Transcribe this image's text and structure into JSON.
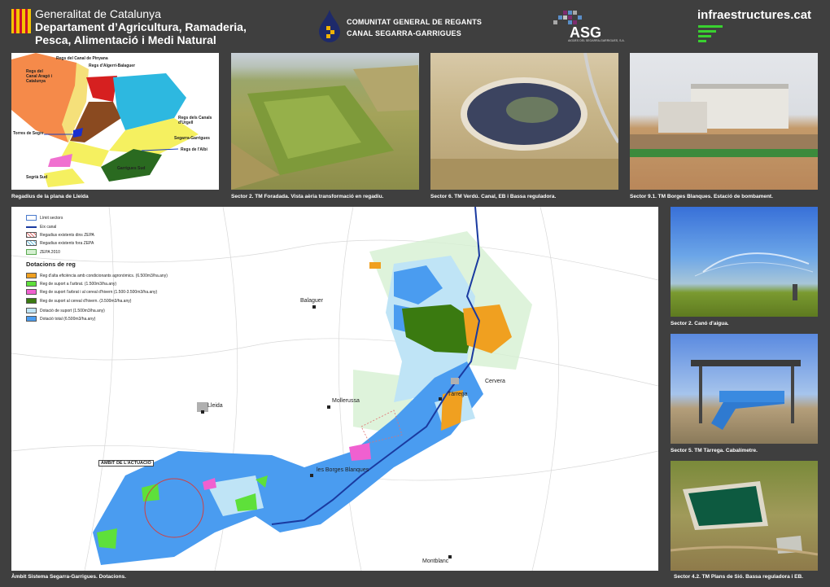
{
  "header": {
    "generalitat_line1": "Generalitat de Catalunya",
    "generalitat_line2": "Departament d’Agricultura, Ramaderia,",
    "generalitat_line3": "Pesca, Alimentació i Medi Natural",
    "comunitat_line1": "COMUNITAT GENERAL DE REGANTS",
    "comunitat_line2": "CANAL SEGARRA-GARRIGUES",
    "asg_logo": "ASG",
    "asg_sub": "AIGÜES DEL SEGARRA-GARRIGUES, S.A.",
    "infra_logo": "infraestructures.cat"
  },
  "captions": {
    "map_small": "Regadius de la plana de Lleida",
    "photo2": "Sector 2. TM Foradada. Vista aèria transformació en regadiu.",
    "photo3": "Sector 6. TM Verdú. Canal, EB i Bassa reguladora.",
    "photo4": "Sector 9.1. TM Borges Blanques. Estació de bombament.",
    "photo5": "Sector 2. Canó d'aigua.",
    "photo6": "Sector 5. TM Tàrrega. Cabalímetre.",
    "photo7": "Sector 4.2. TM Plans de Sió. Bassa reguladora i EB.",
    "big_map": "Àmbit Sistema Segarra-Garrigues. Dotacions."
  },
  "small_map_labels": {
    "pinyana": "Regs del Canal de Pinyana",
    "algerri": "Regs d'Algerri-Balaguer",
    "aragon_cat": "Regs del Canal Aragó i Catalunya",
    "urgell": "Regs dels Canals d'Urgell",
    "torres": "Torres de Segre",
    "segarra": "Segarra-Garrigues",
    "albi": "Regs de l'Albi",
    "garrigues_sud": "Garrigues Sud",
    "segria_sud": "Segrià Sud"
  },
  "legend": {
    "limit": "Límit sectors",
    "canal": "Eix canal",
    "zepa_in": "Regadius existents dins ZEPA",
    "zepa_out": "Regadius existents fora ZEPA",
    "zepa2010": "ZEPA 2010",
    "dotacions_title": "Dotacions de reg",
    "d1": "Reg d'alta eficiència amb condicionants agronòmics. (6.500m3/ha.any)",
    "d2": "Reg de suport a l'arbrat. (1.500m3/ha.any)",
    "d3": "Reg de suport l'arbrat i al cereal d'hivern (1.500-3.500m3/ha.any)",
    "d4": "Reg de suport al cereal d'hivern. (3.500m3/ha.any)",
    "d5": "Dotació de suport (1.500m3/ha.any)",
    "d6": "Dotació total (6.500m3/ha.any)"
  },
  "map_places": {
    "balaguer": "Balaguer",
    "cervera": "Cervera",
    "tarrega": "Tàrrega",
    "mollerussa": "Mollerussa",
    "lleida": "Lleida",
    "borges": "les Borges Blanques",
    "montblanc": "Montblanc",
    "ambit": "ÀMBIT DE L'ACTUACIÓ"
  },
  "colors": {
    "background": "#3f3f3f",
    "orange": "#f0a020",
    "green": "#5ee03a",
    "pink": "#f060d0",
    "darkgreen": "#3a7a10",
    "lightblue": "#bfe4f6",
    "blue": "#4a9cf0",
    "canal": "#1a3aa0"
  }
}
